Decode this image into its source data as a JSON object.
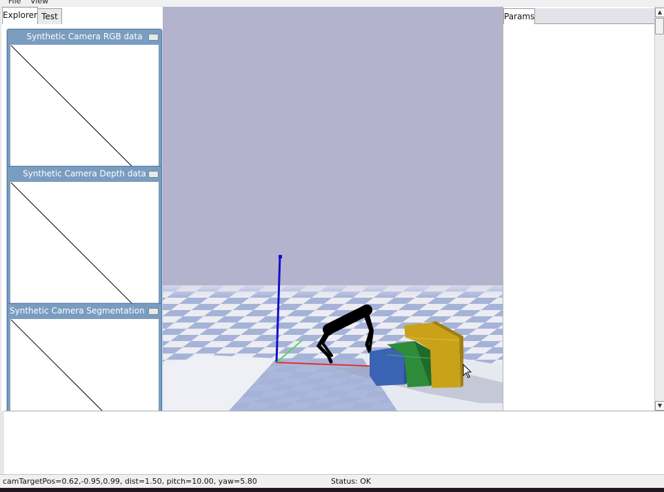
{
  "menu": {
    "items": [
      "File",
      "View"
    ]
  },
  "left_tabs": [
    "Explorer",
    "Test"
  ],
  "right_tabs": [
    "Params"
  ],
  "camera_windows": [
    {
      "title": "Synthetic Camera RGB data"
    },
    {
      "title": "Synthetic Camera Depth data"
    },
    {
      "title": "Synthetic Camera Segmentation Mask"
    }
  ],
  "status": {
    "camera": "camTargetPos=0.62,-0.95,0.99, dist=1.50, pitch=10.00, yaw=5.80",
    "state": "Status: OK"
  },
  "colors": {
    "sky": "#b3b3cd",
    "floor_light": "#ececf2",
    "floor_dark": "#a5b3d8",
    "axis_x": "#e0302a",
    "axis_y": "#55d455",
    "axis_z": "#1010c8",
    "block_blue": "#3b63b4",
    "block_green": "#2e8b3a",
    "block_yellow": "#c9a21a",
    "window_title": "#7a9dbf"
  },
  "icons": [
    "minimize-icon",
    "scroll-up-icon",
    "scroll-down-icon",
    "mouse-cursor-icon"
  ]
}
